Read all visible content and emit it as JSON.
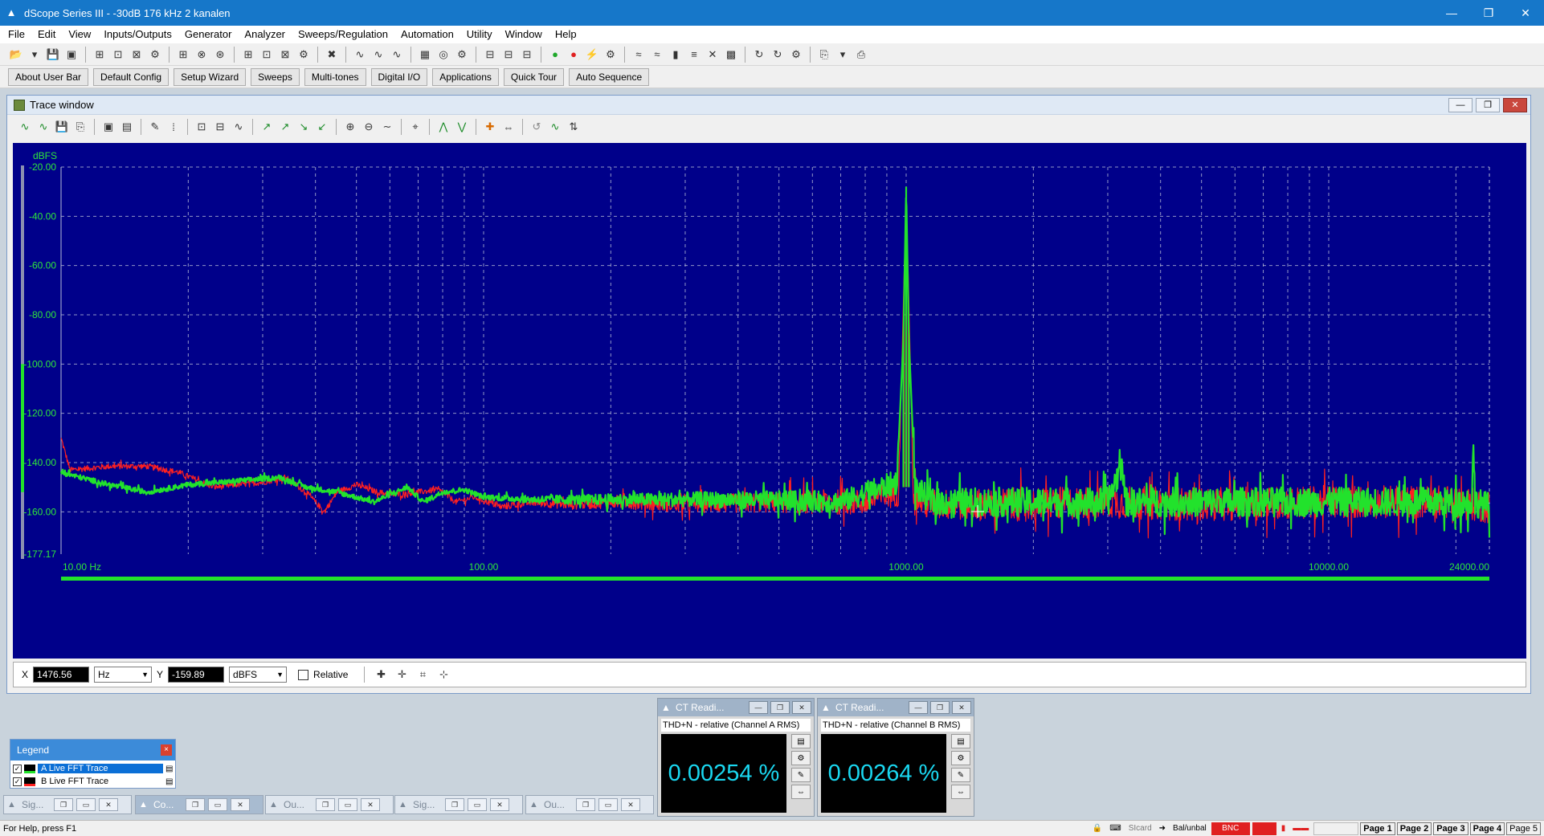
{
  "window": {
    "title": "dScope Series III - -30dB 176 kHz 2 kanalen",
    "controls": [
      "—",
      "❐",
      "✕"
    ]
  },
  "menu": [
    "File",
    "Edit",
    "View",
    "Inputs/Outputs",
    "Generator",
    "Analyzer",
    "Sweeps/Regulation",
    "Automation",
    "Utility",
    "Window",
    "Help"
  ],
  "user_bar": [
    "About User Bar",
    "Default Config",
    "Setup Wizard",
    "Sweeps",
    "Multi-tones",
    "Digital I/O",
    "Applications",
    "Quick Tour",
    "Auto Sequence"
  ],
  "trace_window": {
    "title": "Trace window",
    "readout": {
      "x_label": "X",
      "x_value": "1476.56",
      "x_unit": "Hz",
      "y_label": "Y",
      "y_value": "-159.89",
      "y_unit": "dBFS",
      "relative_label": "Relative"
    }
  },
  "chart_data": {
    "type": "line",
    "ylabel": "dBFS",
    "x_scale": "log",
    "xlim": [
      10,
      24000
    ],
    "ylim": [
      -177.17,
      -20
    ],
    "y_ticks": [
      "-20.00",
      "-40.00",
      "-60.00",
      "-80.00",
      "-100.00",
      "-120.00",
      "-140.00",
      "-160.00",
      "-177.17"
    ],
    "x_ticks": [
      {
        "value": 10,
        "label": "10.00 Hz"
      },
      {
        "value": 100,
        "label": "100.00"
      },
      {
        "value": 1000,
        "label": "1000.00"
      },
      {
        "value": 10000,
        "label": "10000.00"
      },
      {
        "value": 24000,
        "label": "24000.00"
      }
    ],
    "grid": true,
    "series": [
      {
        "color": "#ff2020",
        "points": [
          [
            10,
            -130
          ],
          [
            10.5,
            -143
          ],
          [
            13,
            -141.5
          ],
          [
            16,
            -141.5
          ],
          [
            19,
            -144
          ],
          [
            23,
            -150
          ],
          [
            26,
            -149
          ],
          [
            30,
            -148
          ],
          [
            34,
            -146
          ],
          [
            38,
            -152
          ],
          [
            40,
            -156
          ],
          [
            42,
            -160
          ],
          [
            45,
            -152
          ],
          [
            50,
            -149
          ],
          [
            56,
            -152
          ],
          [
            62,
            -153
          ],
          [
            70,
            -152
          ],
          [
            78,
            -151
          ],
          [
            86,
            -156
          ],
          [
            95,
            -154
          ],
          [
            110,
            -158
          ],
          [
            130,
            -156
          ],
          [
            160,
            -157
          ],
          [
            200,
            -156
          ],
          [
            300,
            -157
          ],
          [
            500,
            -156
          ],
          [
            800,
            -156
          ],
          [
            960,
            -152
          ],
          [
            990,
            -60
          ],
          [
            1000,
            -40
          ],
          [
            1010,
            -60
          ],
          [
            1040,
            -152
          ],
          [
            1100,
            -157
          ],
          [
            1500,
            -157
          ],
          [
            2000,
            -157
          ],
          [
            3000,
            -156
          ],
          [
            5000,
            -157
          ],
          [
            10000,
            -156
          ],
          [
            20000,
            -156
          ],
          [
            24000,
            -158
          ]
        ],
        "noise": 4
      },
      {
        "color": "#22e22c",
        "points": [
          [
            10,
            -144
          ],
          [
            13,
            -149
          ],
          [
            16,
            -152
          ],
          [
            20,
            -149
          ],
          [
            24,
            -148
          ],
          [
            28,
            -147
          ],
          [
            33,
            -146
          ],
          [
            38,
            -150
          ],
          [
            45,
            -152
          ],
          [
            55,
            -156
          ],
          [
            60,
            -153
          ],
          [
            66,
            -150
          ],
          [
            72,
            -156
          ],
          [
            80,
            -152
          ],
          [
            90,
            -151
          ],
          [
            100,
            -154
          ],
          [
            130,
            -155
          ],
          [
            200,
            -155
          ],
          [
            400,
            -155
          ],
          [
            700,
            -156
          ],
          [
            950,
            -148
          ],
          [
            985,
            -90
          ],
          [
            1000,
            -28
          ],
          [
            1015,
            -90
          ],
          [
            1050,
            -150
          ],
          [
            1150,
            -156
          ],
          [
            2000,
            -156
          ],
          [
            3000,
            -156
          ],
          [
            3250,
            -140
          ],
          [
            3300,
            -156
          ],
          [
            6000,
            -156
          ],
          [
            12000,
            -156
          ],
          [
            21800,
            -156
          ],
          [
            22000,
            -133
          ],
          [
            22200,
            -156
          ],
          [
            24000,
            -158
          ]
        ],
        "noise": 3.5
      }
    ]
  },
  "legend": {
    "title": "Legend",
    "items": [
      {
        "label": "A  Live FFT Trace",
        "color": "#22e22c",
        "selected": true
      },
      {
        "label": "B  Live FFT Trace",
        "color": "#ff2020",
        "selected": false
      }
    ]
  },
  "ct_readings": [
    {
      "title": "CT Readi...",
      "label": "THD+N - relative (Channel A RMS)",
      "value": "0.00254 %"
    },
    {
      "title": "CT Readi...",
      "label": "THD+N - relative (Channel B RMS)",
      "value": "0.00264 %"
    }
  ],
  "minimized_windows": [
    {
      "title": "Sig...",
      "active": false
    },
    {
      "title": "Co...",
      "active": true
    },
    {
      "title": "Ou...",
      "active": false
    },
    {
      "title": "Sig...",
      "active": false
    },
    {
      "title": "Ou...",
      "active": false
    }
  ],
  "status_bar": {
    "help": "For Help, press F1",
    "items": [
      "SIcard",
      "Bal/unbal",
      "BNC"
    ],
    "pages": [
      "Page 1",
      "Page 2",
      "Page 3",
      "Page 4",
      "Page 5"
    ]
  },
  "colors": {
    "graph_bg": "#00008a",
    "grid": "#b6bcd6",
    "axis_text": "#2ee83a",
    "title_bar": "#1677c9",
    "readout_text": "#1ad7f0"
  }
}
